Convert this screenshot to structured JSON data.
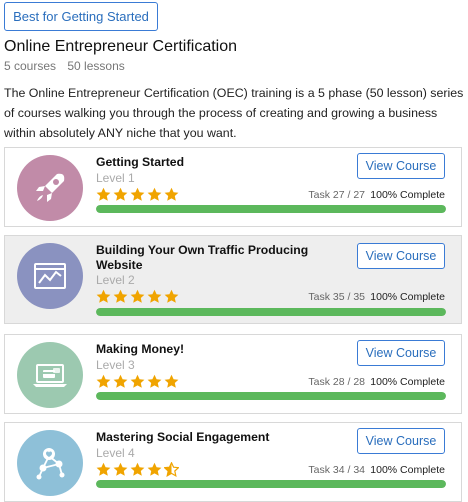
{
  "header": {
    "tag_button": "Best for Getting Started",
    "title": "Online Entrepreneur Certification",
    "courses": "5 courses",
    "lessons": "50 lessons",
    "description": "The Online Entrepreneur Certification (OEC) training is a 5 phase (50 lesson) series of courses walking you through the process of creating and growing a business within absolutely ANY niche that you want."
  },
  "colors": {
    "accent": "#2a6ebd",
    "progress": "#5cb85c",
    "star": "#f0a400"
  },
  "courses": [
    {
      "title": "Getting Started",
      "level": "Level 1",
      "task": "Task 27 / 27",
      "complete_text": "100% Complete",
      "progress": 1.0,
      "rating": 5,
      "button": "View Course",
      "icon": "rocket-icon",
      "icon_color": "#c18ba8"
    },
    {
      "title": "Building Your Own Traffic Producing Website",
      "level": "Level 2",
      "task": "Task 35 / 35",
      "complete_text": "100% Complete",
      "progress": 1.0,
      "rating": 5,
      "button": "View Course",
      "icon": "website-chart-icon",
      "icon_color": "#8a92c0"
    },
    {
      "title": "Making Money!",
      "level": "Level 3",
      "task": "Task 28 / 28",
      "complete_text": "100% Complete",
      "progress": 1.0,
      "rating": 5,
      "button": "View Course",
      "icon": "laptop-payment-icon",
      "icon_color": "#9cc9b0"
    },
    {
      "title": "Mastering Social Engagement",
      "level": "Level 4",
      "task": "Task 34 / 34",
      "complete_text": "100% Complete",
      "progress": 1.0,
      "rating": 4.5,
      "button": "View Course",
      "icon": "social-network-icon",
      "icon_color": "#8ec0d8"
    }
  ]
}
